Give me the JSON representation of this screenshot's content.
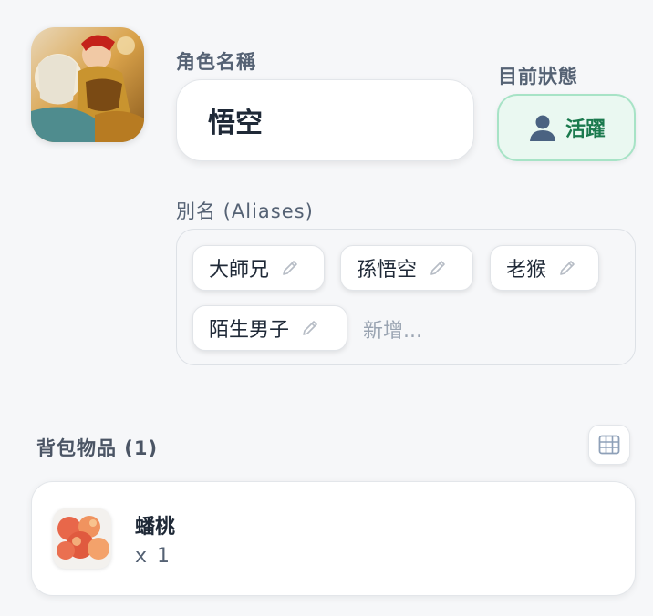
{
  "character": {
    "name_label": "角色名稱",
    "name_value": "悟空",
    "status_label": "目前狀態",
    "status_value": "活躍",
    "avatar_icon": "character-portrait"
  },
  "aliases": {
    "label": "別名 (Aliases)",
    "items": [
      "大師兄",
      "孫悟空",
      "老猴",
      "陌生男子"
    ],
    "add_placeholder": "新增..."
  },
  "inventory": {
    "title": "背包物品 (1)",
    "view_toggle_icon": "grid-icon",
    "items": [
      {
        "name": "蟠桃",
        "quantity": "x 1",
        "icon": "peach-image"
      }
    ]
  },
  "colors": {
    "status_bg": "#eaf8f1",
    "status_border": "#a7e3c6",
    "status_text": "#1b7a4e",
    "label": "#556274"
  }
}
